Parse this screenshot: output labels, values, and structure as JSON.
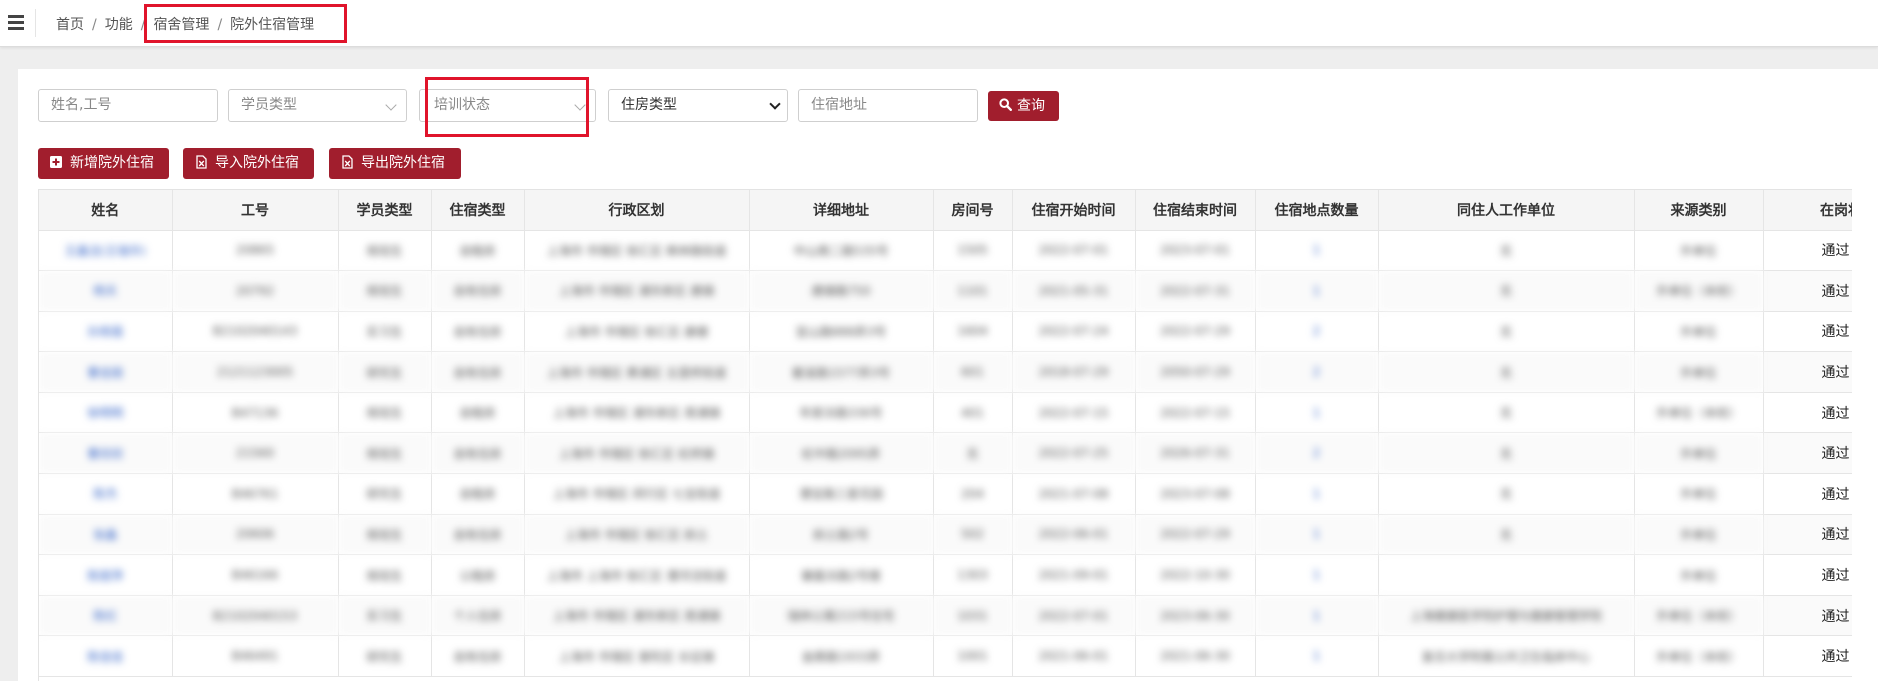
{
  "breadcrumb": {
    "home": "首页",
    "function": "功能",
    "dormitory": "宿舍管理",
    "current": "院外住宿管理"
  },
  "filters": {
    "name_placeholder": "姓名,工号",
    "student_type": "学员类型",
    "training_status": "培训状态",
    "housing_type": "住房类型",
    "address_placeholder": "住宿地址",
    "query_label": "查询"
  },
  "actions": {
    "add": "新增院外住宿",
    "import": "导入院外住宿",
    "export": "导出院外住宿"
  },
  "colors": {
    "primary": "#a11e2d",
    "highlight": "#e0142b",
    "link": "#3a68c9"
  },
  "table": {
    "columns": [
      "姓名",
      "工号",
      "学员类型",
      "住宿类型",
      "行政区划",
      "详细地址",
      "房间号",
      "住宿开始时间",
      "住宿结束时间",
      "住宿地点数量",
      "同住人工作单位",
      "来源类别",
      "在岗状"
    ],
    "rows": [
      [
        "王鑫洁(王瑞华)",
        "20865",
        "规培生",
        "自租房",
        "上海市 市辖区 徐汇区 枫林路街道",
        "中山南二路535号",
        "1505",
        "2022-07-01",
        "2023-07-01",
        "1",
        "无",
        "外单位",
        "通过"
      ],
      [
        "杨天",
        "20792",
        "规培生",
        "自有住房",
        "上海市 市辖区 浦东新区 唐镇",
        "唐镇路750",
        "1101",
        "2021-05-31",
        "2022-07-31",
        "1",
        "无",
        "外单位（本校）",
        "通过"
      ],
      [
        "孙雨蓓",
        "B2102040143",
        "实习生",
        "自有住房",
        "上海市 市辖区 徐汇区 康健",
        "宜山路888弄3号",
        "1604",
        "2022-07-24",
        "2022-07-29",
        "2",
        "无",
        "外单位",
        "通过"
      ],
      [
        "曹佳丽",
        "2121123005",
        "研究生",
        "自有住房",
        "上海市 市辖区 黄浦区 五里桥街道",
        "瞿溪路1577弄3号",
        "601",
        "2018-07-29",
        "2050-07-29",
        "2",
        "无",
        "外单位",
        "通过"
      ],
      [
        "徐明明",
        "B47136",
        "规培生",
        "自租房",
        "上海市 市辖区 浦东新区 周浦镇",
        "年家浜路336号",
        "401",
        "2022-07-15",
        "2022-07-15",
        "1",
        "无",
        "外单位（本校）",
        "通过"
      ],
      [
        "曹欣欣",
        "21560",
        "规培生",
        "自有住房",
        "上海市 市辖区 徐汇区 虹桥镇",
        "虹中路2095弄",
        "无",
        "2022-07-25",
        "2026-07-31",
        "2",
        "无",
        "外单位",
        "通过"
      ],
      [
        "陈杰",
        "B46761",
        "研究生",
        "自租房",
        "上海市 市辖区 闵行区 七宝街道",
        "漕宝路三星花园",
        "204",
        "2021-07-08",
        "2023-07-08",
        "1",
        "无",
        "外单位",
        "通过"
      ],
      [
        "张鑫",
        "20606",
        "规培生",
        "自有住房",
        "上海市 市辖区 徐汇区 斜土",
        "斜土路2号",
        "502",
        "2022-06-01",
        "2022-07-29",
        "1",
        "无",
        "外单位",
        "通过"
      ],
      [
        "陈丽萍",
        "B46166",
        "规培生",
        "公租房",
        "上海市 上海市 徐汇区 漕河泾街道",
        "肇嘉浜路2号楼",
        "1303",
        "2021-09-01",
        "2022-10-30",
        "1",
        "",
        "外单位",
        "通过"
      ],
      [
        "陈红",
        "B2102040153",
        "实习生",
        "个人住房",
        "上海市 市辖区 浦东新区 周浦镇",
        "瑞林公寓215号住宅",
        "1031",
        "2022-07-01",
        "2023-06-30",
        "1",
        "上海健康医学院护理与健康管理学院",
        "外单位（本校）",
        "通过"
      ],
      [
        "陈佳佳",
        "B46491",
        "研究生",
        "自有住房",
        "上海市 市辖区 普陀区 长征镇",
        "金鼎路1933弄",
        "1001",
        "2021-06-01",
        "2021-06-30",
        "1",
        "复旦大学附属公共卫生临床中心",
        "外单位（本校）",
        "通过"
      ]
    ]
  }
}
